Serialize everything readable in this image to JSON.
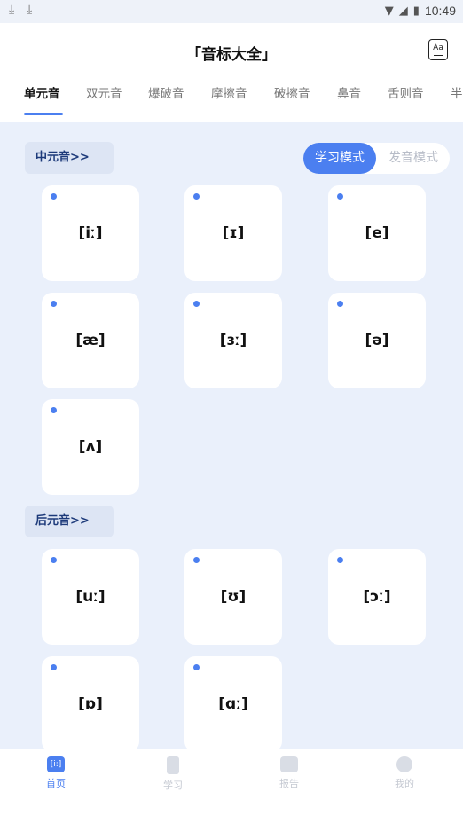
{
  "status_bar": {
    "time": "10:49"
  },
  "header": {
    "title": "「音标大全」",
    "font_button_label": "Aa"
  },
  "tabs": [
    "单元音",
    "双元音",
    "爆破音",
    "摩擦音",
    "破擦音",
    "鼻音",
    "舌则音",
    "半"
  ],
  "mode_toggle": {
    "active": "学习模式",
    "inactive": "发音模式"
  },
  "sections": [
    {
      "label": "中元音>>",
      "symbols": [
        "[iː]",
        "[ɪ]",
        "[e]",
        "[æ]",
        "[ɜː]",
        "[ə]",
        "[ʌ]"
      ]
    },
    {
      "label": "后元音>>",
      "symbols": [
        "[uː]",
        "[ʊ]",
        "[ɔː]",
        "[ɒ]",
        "[ɑː]"
      ]
    }
  ],
  "bottom_nav": [
    {
      "label": "首页",
      "icon": "home-icon"
    },
    {
      "label": "学习",
      "icon": "study-icon"
    },
    {
      "label": "报告",
      "icon": "report-icon"
    },
    {
      "label": "我的",
      "icon": "profile-icon"
    }
  ],
  "colors": {
    "accent": "#4b7ff0",
    "background": "#eaf0fb",
    "section_label_bg": "#dde5f4"
  }
}
